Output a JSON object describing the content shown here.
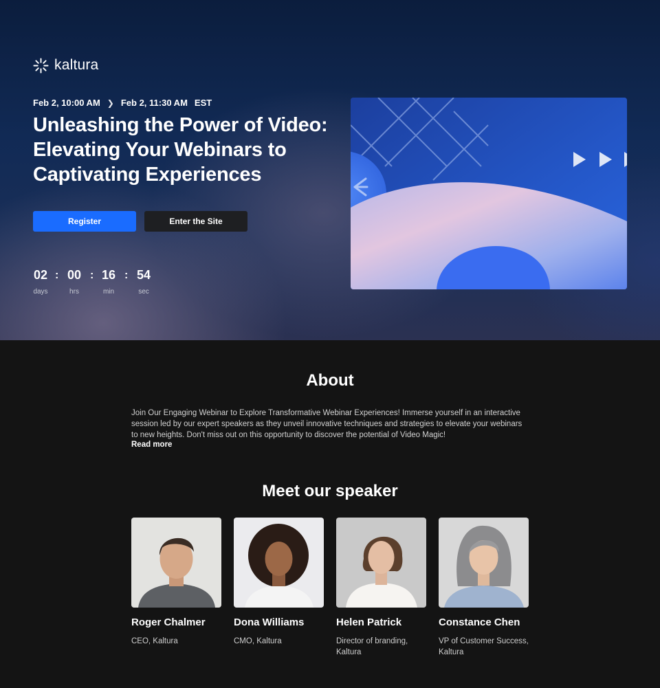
{
  "brand": {
    "name": "kaltura"
  },
  "event": {
    "start": "Feb 2, 10:00 AM",
    "end": "Feb 2, 11:30 AM",
    "timezone": "EST",
    "title": "Unleashing the Power of Video: Elevating Your Webinars to Captivating Experiences"
  },
  "buttons": {
    "register": "Register",
    "enter": "Enter the Site"
  },
  "countdown": {
    "days": "02",
    "hours": "00",
    "minutes": "16",
    "seconds": "54",
    "days_label": "days",
    "hours_label": "hrs",
    "minutes_label": "min",
    "seconds_label": "sec",
    "separator": ":"
  },
  "about": {
    "title": "About",
    "text": "Join Our Engaging Webinar to Explore Transformative Webinar Experiences! Immerse yourself in an interactive session led by our expert speakers as they unveil innovative techniques and strategies to elevate your webinars to new heights. Don't miss out on this opportunity to discover the potential of Video Magic!",
    "read_more": "Read more"
  },
  "speakers": {
    "title": "Meet our speaker",
    "items": [
      {
        "name": "Roger Chalmer",
        "role": "CEO, Kaltura"
      },
      {
        "name": "Dona Williams",
        "role": "CMO, Kaltura"
      },
      {
        "name": "Helen Patrick",
        "role": "Director of branding, Kaltura"
      },
      {
        "name": "Constance Chen",
        "role": "VP of Customer Success, Kaltura"
      }
    ]
  },
  "colors": {
    "accent": "#1a6cff",
    "background": "#141414",
    "hero": "#112a55"
  },
  "icons": {
    "logo": "kaltura-burst-icon",
    "date_separator": "chevron-right-icon",
    "thumbnail": "play-arrows-icon"
  }
}
